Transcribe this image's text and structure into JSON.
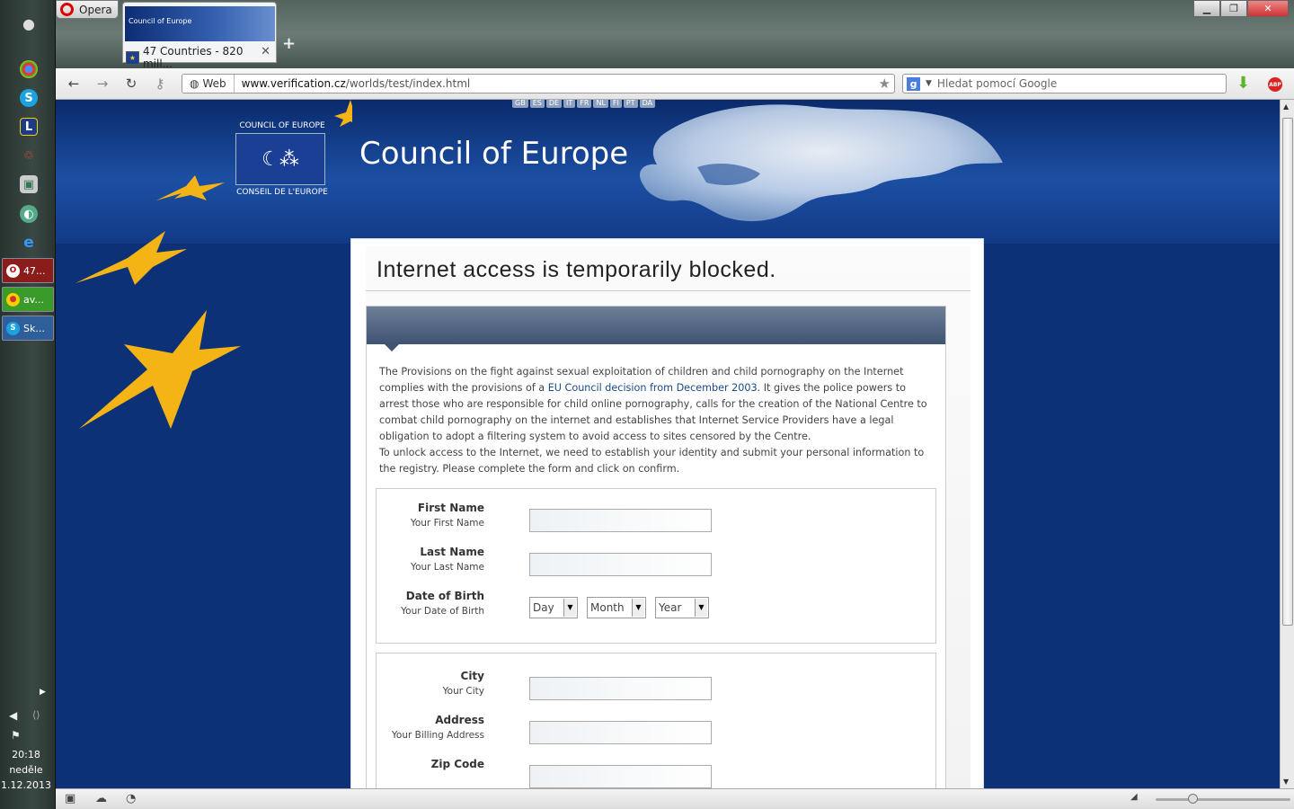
{
  "taskbar": {
    "tasks": [
      {
        "label": "47...",
        "icon": "opera-icon",
        "color": "#c0392b"
      },
      {
        "label": "av...",
        "icon": "chrome-icon",
        "color": "#3a9a2a"
      },
      {
        "label": "Sk...",
        "icon": "skype-icon",
        "color": "#2f5f9a"
      }
    ],
    "clock": {
      "time": "20:18",
      "day": "neděle",
      "date": "1.12.2013"
    }
  },
  "browser": {
    "menu_label": "Opera",
    "tab": {
      "title": "47 Countries - 820 mill...",
      "thumb_text": "Council of Europe"
    },
    "address": {
      "mode": "Web",
      "host": "www.verification.cz",
      "path": "/worlds/test/index.html"
    },
    "search_placeholder": "Hledat pomocí Google"
  },
  "page": {
    "languages": [
      "GB",
      "ES",
      "DE",
      "IT",
      "FR",
      "NL",
      "FI",
      "PT",
      "DA"
    ],
    "logo_top": "COUNCIL OF EUROPE",
    "logo_bottom": "CONSEIL DE L'EUROPE",
    "site_title": "Council of Europe",
    "headline": "Internet access is temporarily blocked.",
    "intro_before_link": "The Provisions on the fight against sexual exploitation of children and child pornography on the Internet complies with the provisions of a ",
    "intro_link": "EU Council decision from December 2003",
    "intro_after_link": ". It gives the police powers to arrest those who are responsible for child online pornography, calls for the creation of the National Centre to combat child pornography on the internet and establishes that Internet Service Providers have a legal obligation to adopt a filtering system to avoid access to sites censored by the Centre.",
    "intro_2": "To unlock access to the Internet, we need to establish your identity and submit your personal information to the registry. Please complete the form and click on confirm.",
    "form1": {
      "first_name": {
        "label": "First Name",
        "sub": "Your First Name"
      },
      "last_name": {
        "label": "Last Name",
        "sub": "Your Last Name"
      },
      "dob": {
        "label": "Date of Birth",
        "sub": "Your Date of Birth",
        "day": "Day",
        "month": "Month",
        "year": "Year"
      }
    },
    "form2": {
      "city": {
        "label": "City",
        "sub": "Your City"
      },
      "address": {
        "label": "Address",
        "sub": "Your Billing Address"
      },
      "zip": {
        "label": "Zip Code"
      }
    }
  },
  "colors": {
    "banner_blue": "#0d3177",
    "star_yellow": "#f5b416",
    "link": "#1a4a8c"
  }
}
